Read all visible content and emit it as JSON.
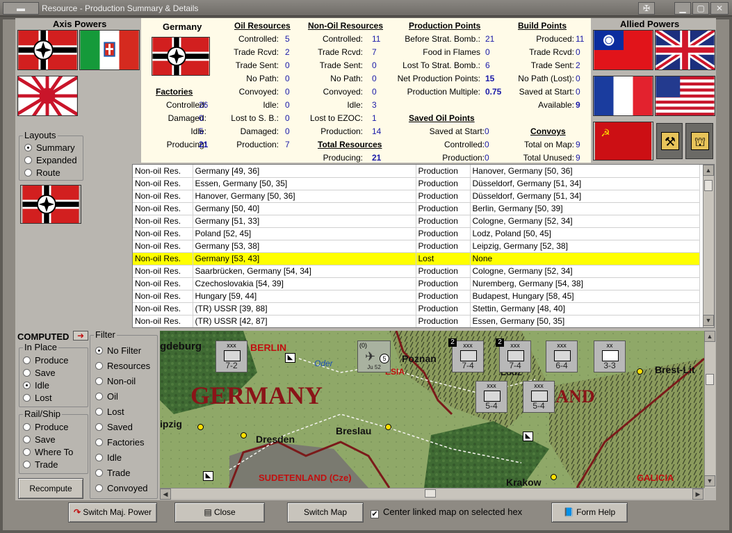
{
  "window": {
    "title": "Resource - Production Summary & Details"
  },
  "axis": {
    "title": "Axis Powers"
  },
  "allied": {
    "title": "Allied Powers"
  },
  "layouts": {
    "title": "Layouts",
    "options": [
      "Summary",
      "Expanded",
      "Route"
    ],
    "selected": "Summary"
  },
  "summary": {
    "country": "Germany",
    "factories": {
      "title": "Factories",
      "rows": [
        {
          "label": "Controlled:",
          "value": "26"
        },
        {
          "label": "Damaged:",
          "value": "0"
        },
        {
          "label": "Idle:",
          "value": "5"
        },
        {
          "label": "Producing:",
          "value": "21"
        }
      ]
    },
    "oil": {
      "title": "Oil Resources",
      "rows": [
        {
          "label": "Controlled:",
          "value": "5"
        },
        {
          "label": "Trade Rcvd:",
          "value": "2"
        },
        {
          "label": "Trade Sent:",
          "value": "0"
        },
        {
          "label": "No Path:",
          "value": "0"
        },
        {
          "label": "Convoyed:",
          "value": "0"
        },
        {
          "label": "Idle:",
          "value": "0"
        },
        {
          "label": "Lost to S. B.:",
          "value": "0"
        },
        {
          "label": "Damaged:",
          "value": "0"
        },
        {
          "label": "Production:",
          "value": "7"
        }
      ]
    },
    "nonoil": {
      "title": "Non-Oil Resources",
      "rows": [
        {
          "label": "Controlled:",
          "value": "11"
        },
        {
          "label": "Trade Rcvd:",
          "value": "7"
        },
        {
          "label": "Trade Sent:",
          "value": "0"
        },
        {
          "label": "No Path:",
          "value": "0"
        },
        {
          "label": "Convoyed:",
          "value": "0"
        },
        {
          "label": "Idle:",
          "value": "3"
        },
        {
          "label": "Lost to EZOC:",
          "value": "1"
        },
        {
          "label": "Production:",
          "value": "14"
        }
      ]
    },
    "total": {
      "title": "Total Resources",
      "rows": [
        {
          "label": "Producing:",
          "value": "21"
        }
      ]
    },
    "prodpoints": {
      "title": "Production Points",
      "rows": [
        {
          "label": "Before Strat. Bomb.:",
          "value": "21"
        },
        {
          "label": "Food in Flames",
          "value": "0"
        },
        {
          "label": "Lost To Strat. Bomb.:",
          "value": "6"
        },
        {
          "label": "Net Production Points:",
          "value": "15"
        },
        {
          "label": "Production Multiple:",
          "value": "0.75"
        }
      ]
    },
    "savedoil": {
      "title": "Saved Oil Points",
      "rows": [
        {
          "label": "Saved at Start:",
          "value": "0"
        },
        {
          "label": "Controlled:",
          "value": "0"
        },
        {
          "label": "Production:",
          "value": "0"
        }
      ]
    },
    "build": {
      "title": "Build Points",
      "rows": [
        {
          "label": "Produced:",
          "value": "11"
        },
        {
          "label": "Trade Rcvd:",
          "value": "0"
        },
        {
          "label": "Trade Sent:",
          "value": "2"
        },
        {
          "label": "No Path (Lost):",
          "value": "0"
        },
        {
          "label": "Saved at Start:",
          "value": "0"
        },
        {
          "label": "Available:",
          "value": "9"
        }
      ]
    },
    "convoys": {
      "title": "Convoys",
      "rows": [
        {
          "label": "Total on Map:",
          "value": "9"
        },
        {
          "label": "Total Unused:",
          "value": "9"
        }
      ]
    }
  },
  "table": {
    "rows": [
      [
        "Non-oil Res.",
        "Germany [49, 36]",
        "Production",
        "Hanover, Germany [50, 36]"
      ],
      [
        "Non-oil Res.",
        "Essen, Germany [50, 35]",
        "Production",
        "Düsseldorf, Germany [51, 34]"
      ],
      [
        "Non-oil Res.",
        "Hanover, Germany [50, 36]",
        "Production",
        "Düsseldorf, Germany [51, 34]"
      ],
      [
        "Non-oil Res.",
        "Germany [50, 40]",
        "Production",
        "Berlin, Germany [50, 39]"
      ],
      [
        "Non-oil Res.",
        "Germany [51, 33]",
        "Production",
        "Cologne, Germany [52, 34]"
      ],
      [
        "Non-oil Res.",
        "Poland [52, 45]",
        "Production",
        "Lodz, Poland [50, 45]"
      ],
      [
        "Non-oil Res.",
        "Germany [53, 38]",
        "Production",
        "Leipzig, Germany [52, 38]"
      ],
      [
        "Non-oil Res.",
        "Germany [53, 43]",
        "Lost",
        "None"
      ],
      [
        "Non-oil Res.",
        "Saarbrücken, Germany [54, 34]",
        "Production",
        "Cologne, Germany [52, 34]"
      ],
      [
        "Non-oil Res.",
        "Czechoslovakia [54, 39]",
        "Production",
        "Nuremberg, Germany [54, 38]"
      ],
      [
        "Non-oil Res.",
        "Hungary [59, 44]",
        "Production",
        "Budapest, Hungary [58, 45]"
      ],
      [
        "Non-oil Res.",
        "(TR) USSR [39, 88]",
        "Production",
        "Stettin, Germany [48, 40]"
      ],
      [
        "Non-oil Res.",
        "(TR) USSR [42, 87]",
        "Production",
        "Essen, Germany [50, 35]"
      ]
    ],
    "selected_index": 7
  },
  "computed": {
    "label": "COMPUTED"
  },
  "inplace": {
    "title": "In Place",
    "options": [
      "Produce",
      "Save",
      "Idle",
      "Lost"
    ],
    "selected": "Idle"
  },
  "railship": {
    "title": "Rail/Ship",
    "options": [
      "Produce",
      "Save",
      "Where To",
      "Trade"
    ]
  },
  "recompute": {
    "label": "Recompute"
  },
  "filter": {
    "title": "Filter",
    "options": [
      "No Filter",
      "Resources",
      "Non-oil",
      "Oil",
      "Lost",
      "Saved",
      "Factories",
      "Idle",
      "Trade",
      "Convoyed"
    ],
    "selected": "No Filter"
  },
  "map": {
    "labels": {
      "magdeburg": "gdeburg",
      "berlin": "BERLIN",
      "oder": "Oder",
      "poznan": "Poznan",
      "germany": "GERMANY",
      "poland": "LAND",
      "dresden": "Dresden",
      "breslau": "Breslau",
      "leipzig": "ipzig",
      "sudetenland": "SUDETENLAND (Cze)",
      "krakow": "Krakow",
      "galicia": "GALICIA",
      "brest": "Brest-Lit",
      "esia": "ESIA",
      "lodz": "Lodz"
    },
    "counters": [
      {
        "top": "xxx",
        "side": "",
        "strength": "7-2",
        "kind": "mech"
      },
      {
        "top": "(0)",
        "side": "",
        "strength": "Ju 52",
        "kind": "air",
        "badge": "5"
      },
      {
        "top": "xxx",
        "side": "",
        "strength": "7-4",
        "kind": "inf",
        "badge": "2"
      },
      {
        "top": "xxx",
        "side": "",
        "strength": "7-4",
        "kind": "inf",
        "badge": "2"
      },
      {
        "top": "xxx",
        "side": "",
        "strength": "6-4",
        "kind": "inf"
      },
      {
        "top": "xx",
        "side": "",
        "strength": "3-3",
        "kind": "hq"
      },
      {
        "top": "xxx",
        "side": "",
        "strength": "5-4",
        "kind": "inf"
      },
      {
        "top": "xxx",
        "side": "",
        "strength": "5-4",
        "kind": "inf"
      }
    ]
  },
  "toolbar": {
    "switch_power": "Switch Maj. Power",
    "close": "Close",
    "switch_map": "Switch Map",
    "center_label": "Center linked map on selected hex",
    "center_checked": "✔",
    "form_help": "Form Help"
  }
}
